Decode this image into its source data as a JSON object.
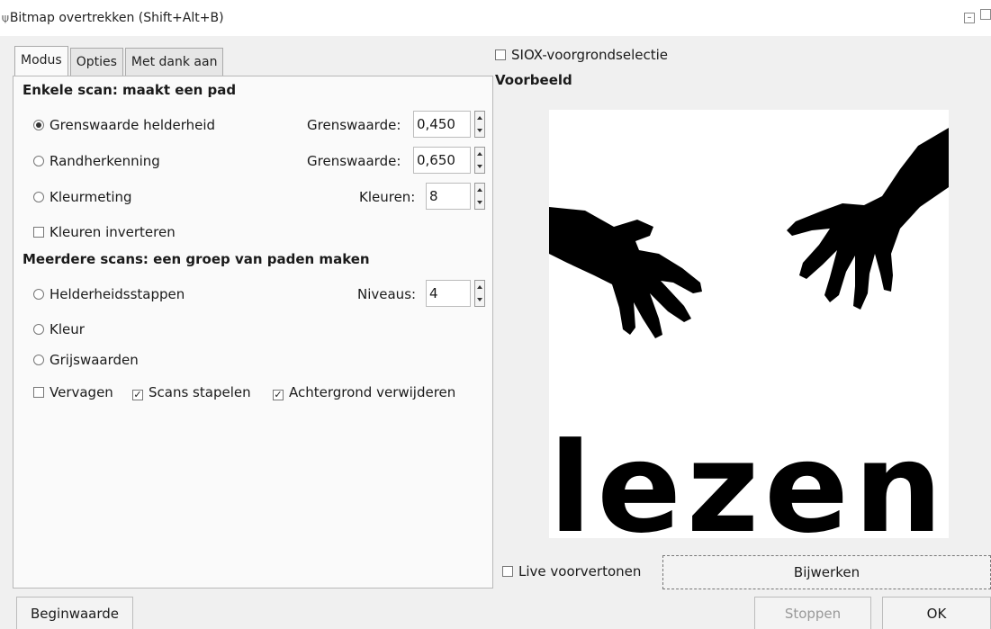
{
  "window": {
    "title": "Bitmap overtrekken (Shift+Alt+B)"
  },
  "tabs": [
    {
      "label": "Modus",
      "active": true
    },
    {
      "label": "Opties",
      "active": false
    },
    {
      "label": "Met dank aan",
      "active": false
    }
  ],
  "single_scan": {
    "heading": "Enkele scan: maakt een pad",
    "brightness": {
      "label": "Grenswaarde helderheid",
      "selected": true,
      "param_label": "Grenswaarde:",
      "value": "0,450"
    },
    "edge": {
      "label": "Randherkenning",
      "selected": false,
      "param_label": "Grenswaarde:",
      "value": "0,650"
    },
    "color": {
      "label": "Kleurmeting",
      "selected": false,
      "param_label": "Kleuren:",
      "value": "8"
    },
    "invert": {
      "label": "Kleuren inverteren",
      "checked": false
    }
  },
  "multi_scan": {
    "heading": "Meerdere scans: een groep van paden maken",
    "brightness_steps": {
      "label": "Helderheidsstappen",
      "selected": false,
      "param_label": "Niveaus:",
      "value": "4"
    },
    "colors": {
      "label": "Kleur",
      "selected": false
    },
    "grays": {
      "label": "Grijswaarden",
      "selected": false
    },
    "smooth": {
      "label": "Vervagen",
      "checked": false
    },
    "stack": {
      "label": "Scans stapelen",
      "checked": true
    },
    "remove_bg": {
      "label": "Achtergrond verwijderen",
      "checked": true
    }
  },
  "siox": {
    "label": "SIOX-voorgrondselectie",
    "checked": false
  },
  "preview": {
    "heading": "Voorbeeld",
    "image_text": "lezen",
    "live": {
      "label": "Live voorvertonen",
      "checked": false
    },
    "update_label": "Bijwerken"
  },
  "footer": {
    "reset_label": "Beginwaarde",
    "stop_label": "Stoppen",
    "ok_label": "OK"
  },
  "colors": {
    "dialog_bg": "#f0f0f0",
    "panel_bg": "#fafafa",
    "preview_ink": "#000000"
  }
}
